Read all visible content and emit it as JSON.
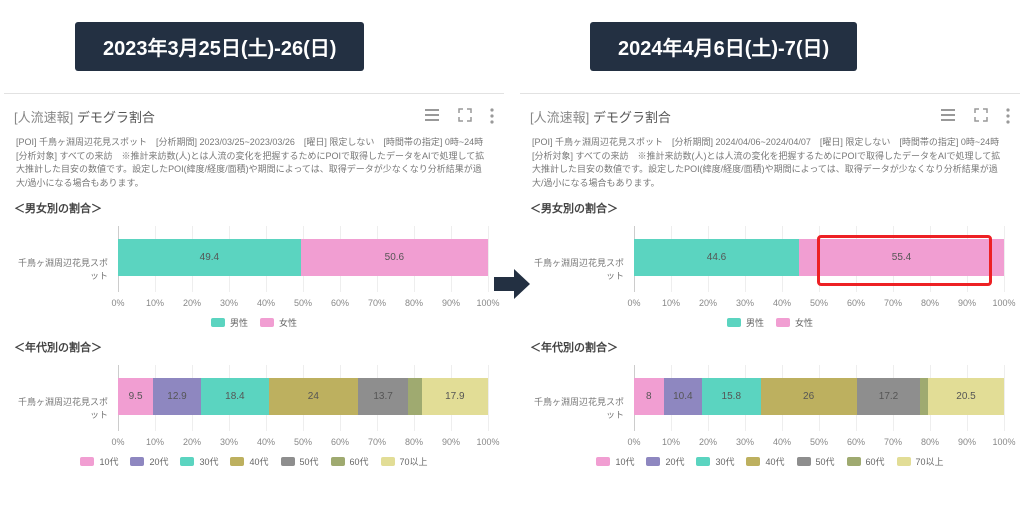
{
  "headers": {
    "left": "2023年3月25日(土)-26(日)",
    "right": "2024年4月6日(土)-7(日)"
  },
  "card": {
    "title_tag": "[人流速報]",
    "title": "デモグラ割合"
  },
  "meta": {
    "left": "[POI] 千鳥ヶ淵周辺花見スポット　[分析期間] 2023/03/25~2023/03/26　[曜日] 限定しない　[時間帯の指定] 0時~24時　[分析対象] すべての来訪　※推計来訪数(人)とは人流の変化を把握するためにPOIで取得したデータをAIで処理して拡大推計した目安の数値です。設定したPOI(緯度/経度/面積)や期間によっては、取得データが少なくなり分析結果が過大/過小になる場合もあります。",
    "right": "[POI] 千鳥ヶ淵周辺花見スポット　[分析期間] 2024/04/06~2024/04/07　[曜日] 限定しない　[時間帯の指定] 0時~24時　[分析対象] すべての来訪　※推計来訪数(人)とは人流の変化を把握するためにPOIで取得したデータをAIで処理して拡大推計した目安の数値です。設定したPOI(緯度/経度/面積)や期間によっては、取得データが少なくなり分析結果が過大/過小になる場合もあります。"
  },
  "axis_ticks": [
    "0%",
    "10%",
    "20%",
    "30%",
    "40%",
    "50%",
    "60%",
    "70%",
    "80%",
    "90%",
    "100%"
  ],
  "ylabel": "千鳥ヶ淵周辺花見スポット",
  "titles": {
    "gender": "＜男女別の割合＞",
    "age": "＜年代別の割合＞"
  },
  "legend": {
    "gender": [
      {
        "name": "男性",
        "color": "#5bd4c0"
      },
      {
        "name": "女性",
        "color": "#f19ed2"
      }
    ],
    "age": [
      {
        "name": "10代",
        "color": "#f19ed2"
      },
      {
        "name": "20代",
        "color": "#8e87c0"
      },
      {
        "name": "30代",
        "color": "#5bd4c0"
      },
      {
        "name": "40代",
        "color": "#bdb05f"
      },
      {
        "name": "50代",
        "color": "#8e8e8e"
      },
      {
        "name": "60代",
        "color": "#9faa70"
      },
      {
        "name": "70以上",
        "color": "#e2dd96"
      }
    ]
  },
  "chart_data": [
    {
      "id": "gender_left",
      "type": "bar",
      "title": "＜男女別の割合＞ 2023",
      "categories": [
        "千鳥ヶ淵周辺花見スポット"
      ],
      "xlim": [
        0,
        100
      ],
      "xlabel": "",
      "ylabel": "",
      "series": [
        {
          "name": "男性",
          "values": [
            49.4
          ],
          "color": "#5bd4c0"
        },
        {
          "name": "女性",
          "values": [
            50.6
          ],
          "color": "#f19ed2"
        }
      ]
    },
    {
      "id": "gender_right",
      "type": "bar",
      "title": "＜男女別の割合＞ 2024",
      "categories": [
        "千鳥ヶ淵周辺花見スポット"
      ],
      "xlim": [
        0,
        100
      ],
      "xlabel": "",
      "ylabel": "",
      "series": [
        {
          "name": "男性",
          "values": [
            44.6
          ],
          "color": "#5bd4c0"
        },
        {
          "name": "女性",
          "values": [
            55.4
          ],
          "color": "#f19ed2"
        }
      ]
    },
    {
      "id": "age_left",
      "type": "bar",
      "title": "＜年代別の割合＞ 2023",
      "categories": [
        "千鳥ヶ淵周辺花見スポット"
      ],
      "xlim": [
        0,
        100
      ],
      "xlabel": "",
      "ylabel": "",
      "series": [
        {
          "name": "10代",
          "values": [
            9.5
          ],
          "color": "#f19ed2"
        },
        {
          "name": "20代",
          "values": [
            12.9
          ],
          "color": "#8e87c0"
        },
        {
          "name": "30代",
          "values": [
            18.4
          ],
          "color": "#5bd4c0"
        },
        {
          "name": "40代",
          "values": [
            24.0
          ],
          "color": "#bdb05f"
        },
        {
          "name": "50代",
          "values": [
            13.7
          ],
          "color": "#8e8e8e"
        },
        {
          "name": "60代",
          "values": [
            3.6
          ],
          "color": "#9faa70"
        },
        {
          "name": "70以上",
          "values": [
            17.9
          ],
          "color": "#e2dd96"
        }
      ]
    },
    {
      "id": "age_right",
      "type": "bar",
      "title": "＜年代別の割合＞ 2024",
      "categories": [
        "千鳥ヶ淵周辺花見スポット"
      ],
      "xlim": [
        0,
        100
      ],
      "xlabel": "",
      "ylabel": "",
      "series": [
        {
          "name": "10代",
          "values": [
            8.0
          ],
          "color": "#f19ed2"
        },
        {
          "name": "20代",
          "values": [
            10.4
          ],
          "color": "#8e87c0"
        },
        {
          "name": "30代",
          "values": [
            15.8
          ],
          "color": "#5bd4c0"
        },
        {
          "name": "40代",
          "values": [
            26.0
          ],
          "color": "#bdb05f"
        },
        {
          "name": "50代",
          "values": [
            17.2
          ],
          "color": "#8e8e8e"
        },
        {
          "name": "60代",
          "values": [
            2.1
          ],
          "color": "#9faa70"
        },
        {
          "name": "70以上",
          "values": [
            20.5
          ],
          "color": "#e2dd96"
        }
      ]
    }
  ],
  "hide_labels_for": [
    "60代"
  ]
}
